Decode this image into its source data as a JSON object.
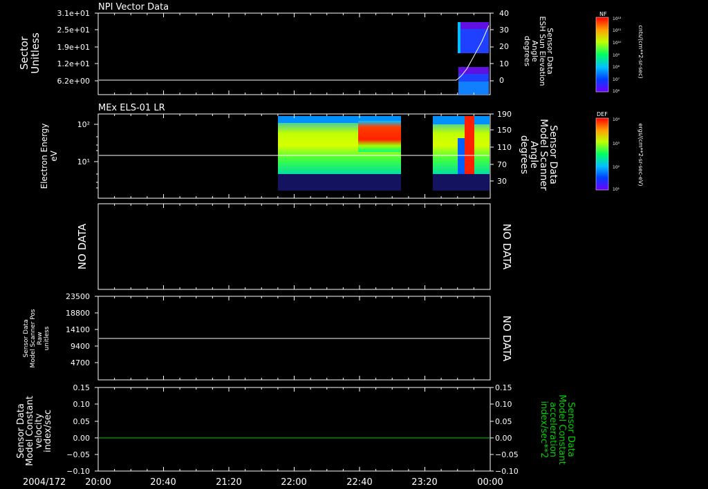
{
  "x_axis": {
    "date_label": "2004/172",
    "ticks": [
      "20:00",
      "20:40",
      "21:20",
      "22:00",
      "22:40",
      "23:20",
      "00:00"
    ]
  },
  "panels": [
    {
      "id": "p1",
      "title": "NPI Vector Data",
      "left_label_lines": [
        "Sector",
        "Unitless"
      ],
      "left_ticks": [
        "3.1e+01",
        "2.5e+01",
        "1.9e+01",
        "1.2e+01",
        "6.2e+00"
      ],
      "right_ticks": [
        "40",
        "30",
        "20",
        "10",
        "0"
      ],
      "right_label_lines": [
        "Sensor Data",
        "ESH Sun Elevation",
        "Angle",
        "degrees"
      ],
      "colorbar": {
        "label": "NF",
        "ticks": [
          "10¹²",
          "10¹¹",
          "10¹⁰",
          "10⁹",
          "10⁸",
          "10⁷",
          "10⁶"
        ],
        "units": "cnts/(cm**2-sr-sec)"
      }
    },
    {
      "id": "p2",
      "title": "MEx ELS-01 LR",
      "left_label_lines": [
        "Electron Energy",
        "eV"
      ],
      "left_ticks": [
        "10²",
        "10¹"
      ],
      "right_ticks": [
        "190",
        "150",
        "110",
        "70",
        "30"
      ],
      "right_label_lines": [
        "Sensor Data",
        "Model Scanner",
        "Angle",
        "degrees"
      ],
      "colorbar": {
        "label": "DEF",
        "ticks": [
          "10⁴",
          "10³",
          "10²",
          "10¹"
        ],
        "units": "ergs/(cm**2-sr-sec-eV)"
      }
    },
    {
      "id": "p3",
      "title": "",
      "left_label_lines": [
        "NO DATA"
      ],
      "left_ticks": [],
      "right_ticks": [],
      "right_label_lines": [
        "NO DATA"
      ]
    },
    {
      "id": "p4",
      "title": "",
      "left_label_lines": [
        "Sensor Data",
        "Model Scanner Pos",
        "Raw",
        "unitless"
      ],
      "left_ticks": [
        "23500",
        "18800",
        "14100",
        "9400",
        "4700"
      ],
      "right_ticks": [],
      "right_label_lines": [
        "NO DATA"
      ]
    },
    {
      "id": "p5",
      "title": "",
      "left_label_lines": [
        "Sensor Data",
        "Model Constant",
        "velocity",
        "index/sec"
      ],
      "left_ticks": [
        "0.15",
        "0.10",
        "0.05",
        "0.00",
        "−0.05",
        "−0.10"
      ],
      "right_ticks": [
        "0.15",
        "0.10",
        "0.05",
        "0.00",
        "−0.05",
        "−0.10"
      ],
      "right_label_lines": [
        "Sensor Data",
        "Model Constant",
        "acceleration",
        "index/sec**2"
      ]
    }
  ],
  "colors": {
    "background": "#000000",
    "foreground": "#ffffff",
    "accent_green": "#00d000"
  },
  "chart_data": [
    {
      "type": "heatmap",
      "title": "NPI Vector Data",
      "ylabel": "Sector Unitless",
      "y2label": "Sensor Data ESH Sun Elevation Angle degrees",
      "x_range": [
        "20:00",
        "00:00"
      ],
      "ylim": [
        0,
        31
      ],
      "y2lim": [
        -10,
        40
      ],
      "line_series": {
        "name": "ESH Sun Elevation Angle",
        "x": [
          "20:00",
          "21:00",
          "22:00",
          "23:00",
          "23:36",
          "23:42",
          "23:48",
          "23:54",
          "00:00"
        ],
        "y": [
          0,
          0,
          0,
          0,
          0,
          5,
          15,
          25,
          33
        ]
      }
    },
    {
      "type": "heatmap",
      "title": "MEx ELS-01 LR",
      "ylabel": "Electron Energy eV",
      "y2label": "Sensor Data Model Scanner Angle degrees",
      "x_range": [
        "20:00",
        "00:00"
      ],
      "y_scale": "log",
      "y2lim": [
        0,
        190
      ],
      "line_series": {
        "name": "Model Scanner Angle",
        "x": [
          "20:00",
          "00:00"
        ],
        "y": [
          90,
          90
        ]
      }
    },
    {
      "type": "line",
      "ylabel": "Sensor Data Model Scanner Pos Raw unitless",
      "ylim": [
        0,
        23500
      ],
      "series": [
        {
          "x": [
            "20:00",
            "00:00"
          ],
          "y": [
            11500,
            11500
          ]
        }
      ]
    },
    {
      "type": "line",
      "ylabel": "Sensor Data Model Constant velocity index/sec",
      "y2label": "Sensor Data Model Constant acceleration index/sec**2",
      "ylim": [
        -0.1,
        0.15
      ],
      "series": [
        {
          "x": [
            "20:00",
            "00:00"
          ],
          "y": [
            0.0,
            0.0
          ]
        }
      ]
    }
  ]
}
